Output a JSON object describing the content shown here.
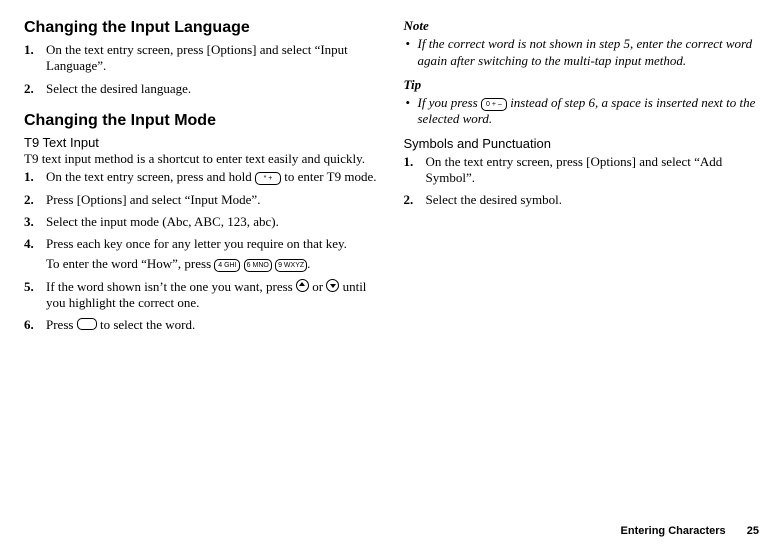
{
  "left": {
    "heading1": "Changing the Input Language",
    "steps1": [
      "On the text entry screen, press [Options] and select “Input Language”.",
      "Select the desired language."
    ],
    "heading2": "Changing the Input Mode",
    "subhead2": "T9 Text Input",
    "intro2": "T9 text input method is a shortcut to enter text easily and quickly.",
    "steps2": {
      "s1a": "On the text entry screen, press and hold ",
      "s1b": " to enter T9 mode.",
      "s2": "Press [Options] and select “Input Mode”.",
      "s3": "Select the input mode (Abc, ABC, 123, abc).",
      "s4": "Press each key once for any letter you require on that key.",
      "s4cont_a": "To enter the word “How”, press ",
      "s4cont_b": ".",
      "s5a": "If the word shown isn’t the one you want, press ",
      "s5mid": " or ",
      "s5b": " until you highlight the correct one.",
      "s6a": "Press ",
      "s6b": " to select the word."
    },
    "keys": {
      "star": "* +",
      "k4": "4 GHI",
      "k6": "6 MNO",
      "k9": "9 WXYZ",
      "k0": "0 + –"
    }
  },
  "right": {
    "noteHead": "Note",
    "noteItems": [
      "If the correct word is not shown in step 5, enter the correct word again after switching to the multi-tap input method."
    ],
    "tipHead": "Tip",
    "tip_a": "If you press ",
    "tip_b": " instead of step 6, a space is inserted next to the selected word.",
    "subhead": "Symbols and Punctuation",
    "steps": [
      "On the text entry screen, press [Options] and select “Add Symbol”.",
      "Select the desired symbol."
    ]
  },
  "footer": {
    "section": "Entering Characters",
    "page": "25"
  }
}
